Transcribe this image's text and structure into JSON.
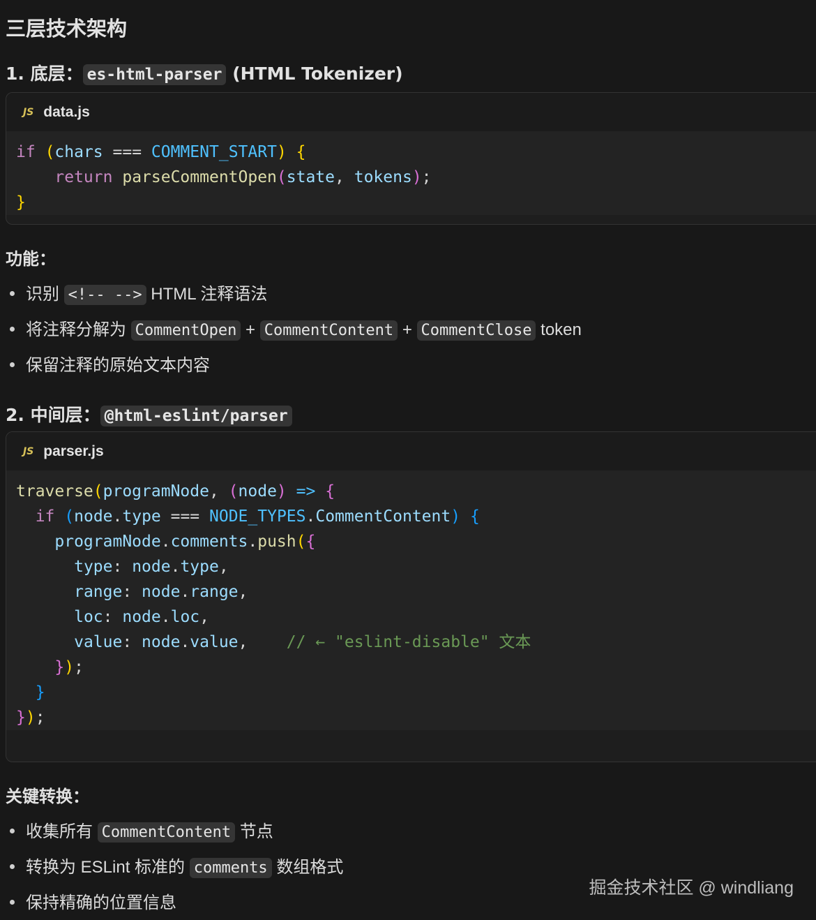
{
  "title": "三层技术架构",
  "section1": {
    "prefix": "1. 底层：",
    "code": "es-html-parser",
    "suffix": "(HTML Tokenizer)",
    "filename": "data.js",
    "file_icon": "JS",
    "lines": [
      [
        "if",
        " ",
        "(",
        "chars",
        " === ",
        "COMMENT_START",
        ")",
        " ",
        "{"
      ],
      [
        "    ",
        "return",
        " ",
        "parseCommentOpen",
        "(",
        "state",
        ", ",
        "tokens",
        ")",
        ";"
      ],
      [
        "}"
      ]
    ]
  },
  "features": {
    "label": "功能：",
    "items": [
      {
        "pre": "识别 ",
        "code": "<!-- -->",
        "post": " HTML 注释语法"
      },
      {
        "pre": "将注释分解为 ",
        "code1": "CommentOpen",
        "mid1": " + ",
        "code2": "CommentContent",
        "mid2": " + ",
        "code3": "CommentClose",
        "post": " token"
      },
      {
        "pre": "保留注释的原始文本内容"
      }
    ]
  },
  "section2": {
    "prefix": "2. 中间层：",
    "code": "@html-eslint/parser",
    "filename": "parser.js",
    "file_icon": "JS",
    "comment": "// ← \"eslint-disable\" 文本"
  },
  "key": {
    "label": "关键转换：",
    "items": [
      {
        "pre": "收集所有 ",
        "code": "CommentContent",
        "post": " 节点"
      },
      {
        "pre": "转换为 ESLint 标准的 ",
        "code": "comments",
        "post": " 数组格式"
      },
      {
        "pre": "保持精确的位置信息"
      }
    ]
  },
  "watermark": "掘金技术社区 @ windliang",
  "colors": {
    "background": "#181818",
    "keyword": "#c586c0",
    "variable": "#9cdcfe",
    "function": "#dcdcaa",
    "constant": "#4fc1ff",
    "comment": "#6a9955"
  }
}
